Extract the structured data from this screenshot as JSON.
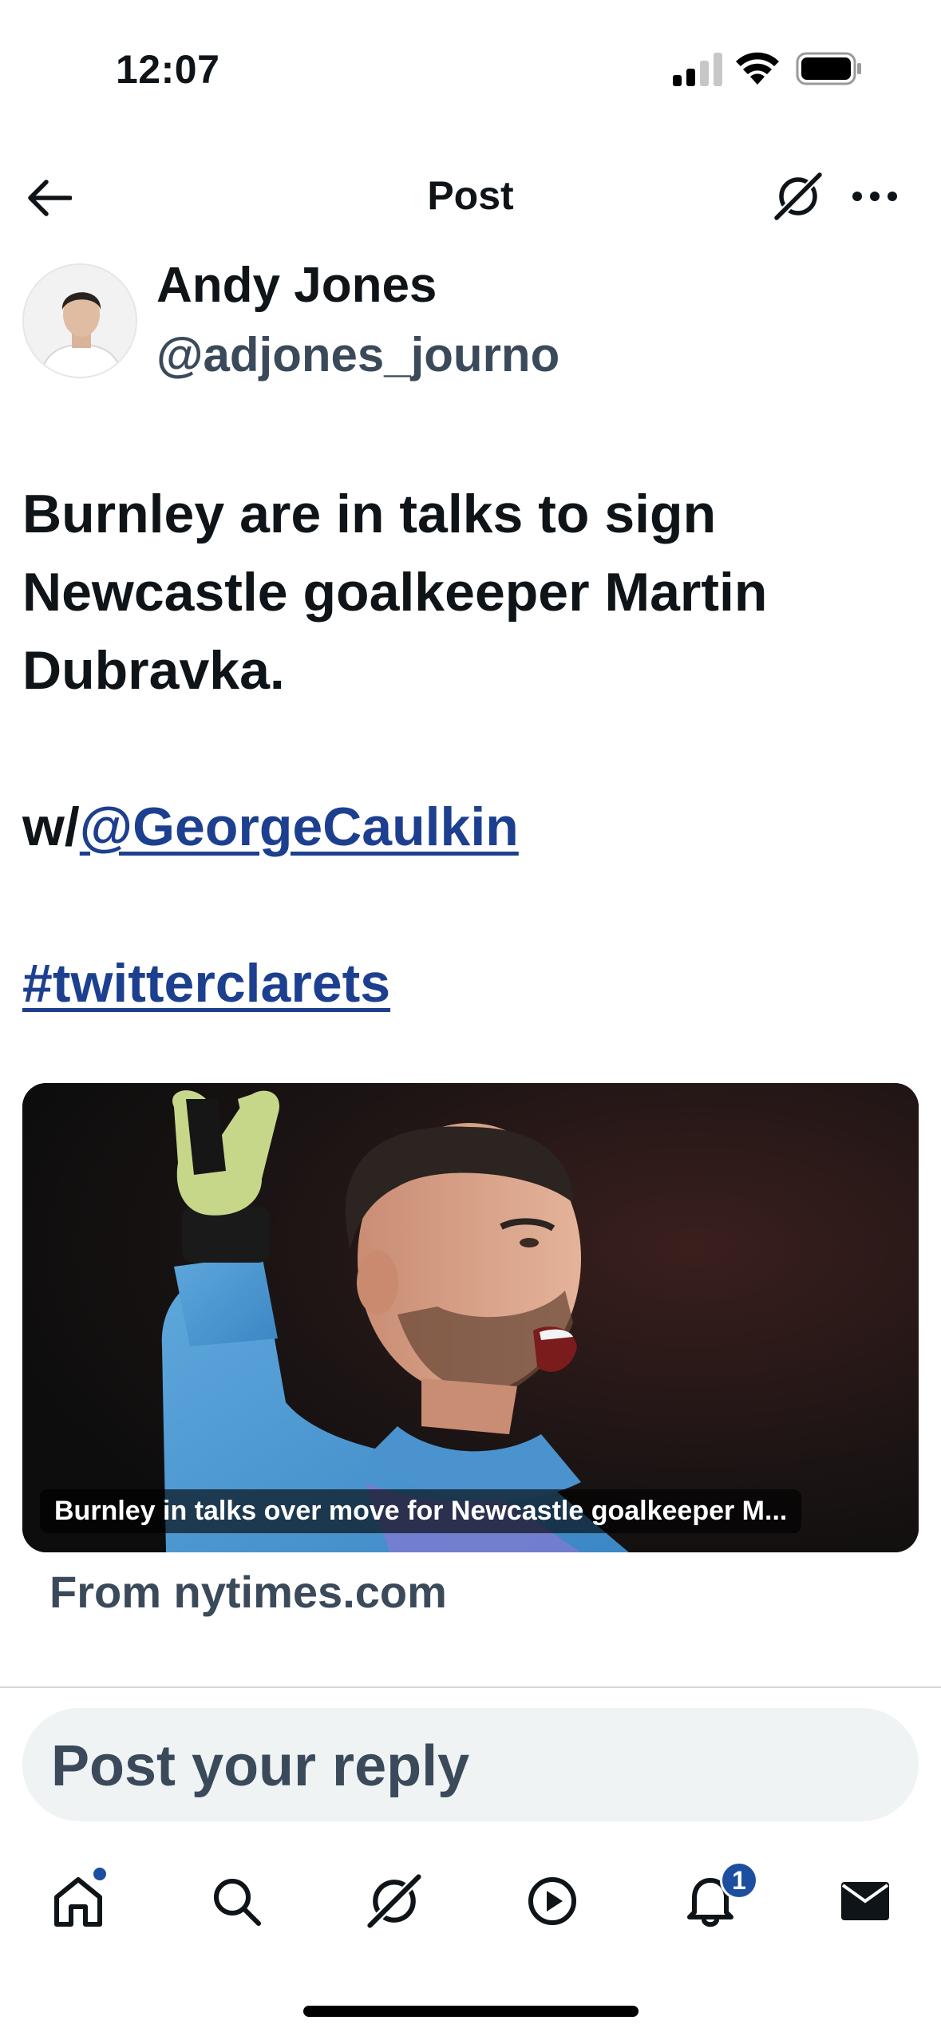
{
  "status_bar": {
    "time": "12:07"
  },
  "header": {
    "title": "Post"
  },
  "author": {
    "name": "Andy Jones",
    "handle": "@adjones_journo"
  },
  "post": {
    "text_lines": [
      "Burnley are in talks to sign",
      "Newcastle goalkeeper Martin",
      "Dubravka."
    ],
    "mention_prefix": "w/",
    "mention": "@GeorgeCaulkin",
    "hashtag": "#twitterclarets"
  },
  "card": {
    "caption": "Burnley in talks over move for Newcastle goalkeeper M...",
    "source": "From nytimes.com"
  },
  "reply": {
    "placeholder": "Post your reply"
  },
  "tabbar": {
    "icons": [
      "home-icon",
      "search-icon",
      "grok-icon",
      "video-icon",
      "bell-icon",
      "mail-icon"
    ],
    "notification_count": "1"
  },
  "colors": {
    "link": "#1d3f8f",
    "accent": "#1d4fa0",
    "secondary_text": "#3b4a5a",
    "reply_bg": "#eff3f4"
  }
}
